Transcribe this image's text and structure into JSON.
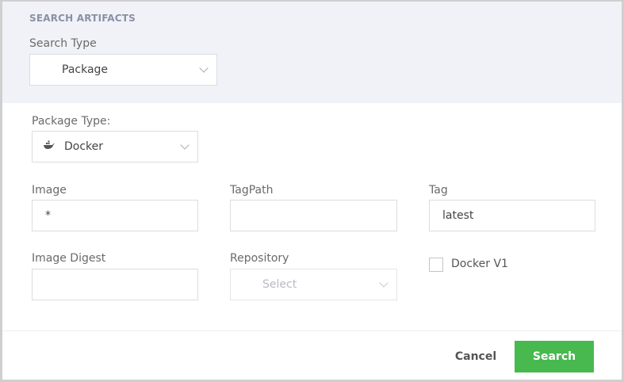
{
  "header": {
    "title": "SEARCH ARTIFACTS",
    "search_type_label": "Search Type",
    "search_type_value": "Package"
  },
  "form": {
    "package_type_label": "Package Type:",
    "package_type_value": "Docker",
    "image_label": "Image",
    "image_value": "*",
    "tagpath_label": "TagPath",
    "tagpath_value": "",
    "tag_label": "Tag",
    "tag_value": "latest",
    "image_digest_label": "Image Digest",
    "image_digest_value": "",
    "repository_label": "Repository",
    "repository_placeholder": "Select",
    "docker_v1_label": "Docker V1",
    "docker_v1_checked": false
  },
  "footer": {
    "cancel_label": "Cancel",
    "search_label": "Search"
  },
  "colors": {
    "accent": "#47b94f",
    "header_bg": "#f1f2f7"
  }
}
